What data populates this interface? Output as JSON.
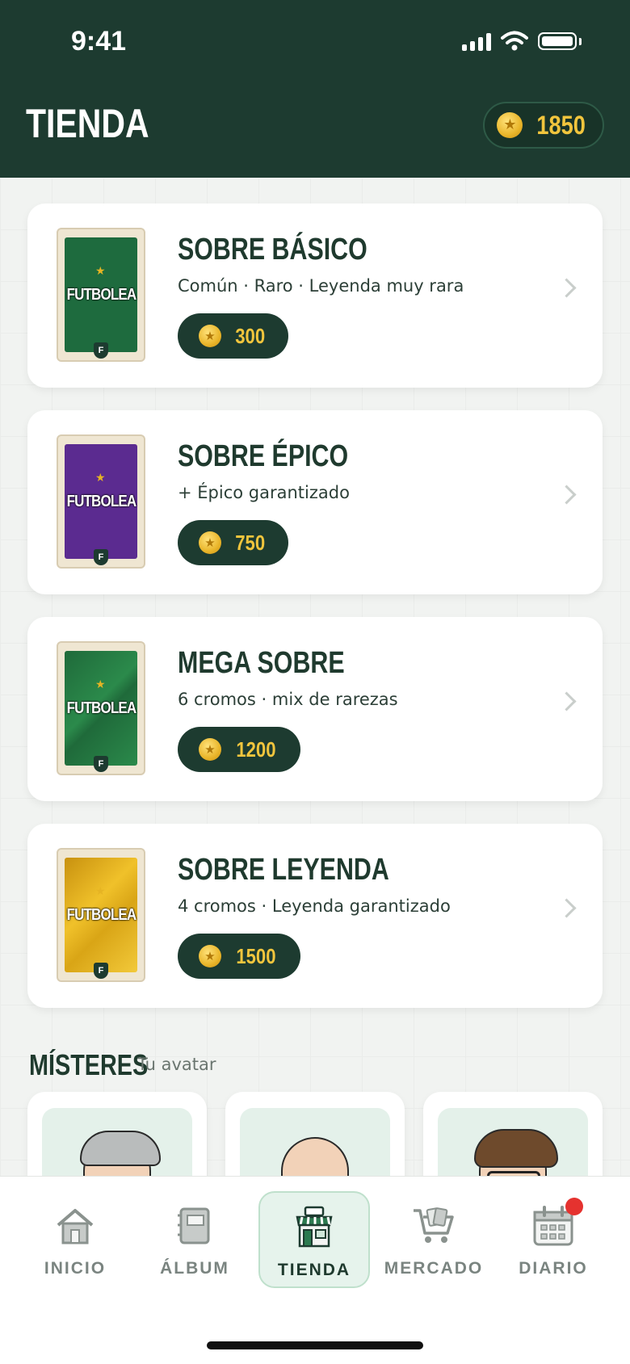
{
  "status_bar": {
    "time": "9:41"
  },
  "header": {
    "title": "TIENDA",
    "coins": "1850"
  },
  "packs": [
    {
      "name": "SOBRE BÁSICO",
      "description": "Común · Raro · Leyenda muy rara",
      "price": "300",
      "color": "#1e6b3e",
      "logo": "FUTBOLEA",
      "badge": "F"
    },
    {
      "name": "SOBRE ÉPICO",
      "description": "+ Épico garantizado",
      "price": "750",
      "color": "#5b2b90",
      "logo": "FUTBOLEA",
      "badge": "F"
    },
    {
      "name": "MEGA SOBRE",
      "description": "6 cromos · mix de rarezas",
      "price": "1200",
      "color": "#1f6a3a",
      "logo": "FUTBOLEA",
      "badge": "F"
    },
    {
      "name": "SOBRE LEYENDA",
      "description": "4 cromos · Leyenda garantizado",
      "price": "1500",
      "color": "#d9a516",
      "logo": "FUTBOLEA",
      "badge": "F"
    }
  ],
  "misteres": {
    "title": "MÍSTERES",
    "subtitle": "Tu avatar"
  },
  "nav": {
    "items": [
      {
        "label": "INICIO",
        "icon": "home-icon"
      },
      {
        "label": "ÁLBUM",
        "icon": "album-icon"
      },
      {
        "label": "TIENDA",
        "icon": "store-icon",
        "active": true
      },
      {
        "label": "MERCADO",
        "icon": "cart-icon"
      },
      {
        "label": "DIARIO",
        "icon": "calendar-icon",
        "badge": true
      }
    ]
  },
  "colors": {
    "primary": "#1d3b30",
    "gold": "#f1c53d",
    "notification": "#e5322f"
  }
}
